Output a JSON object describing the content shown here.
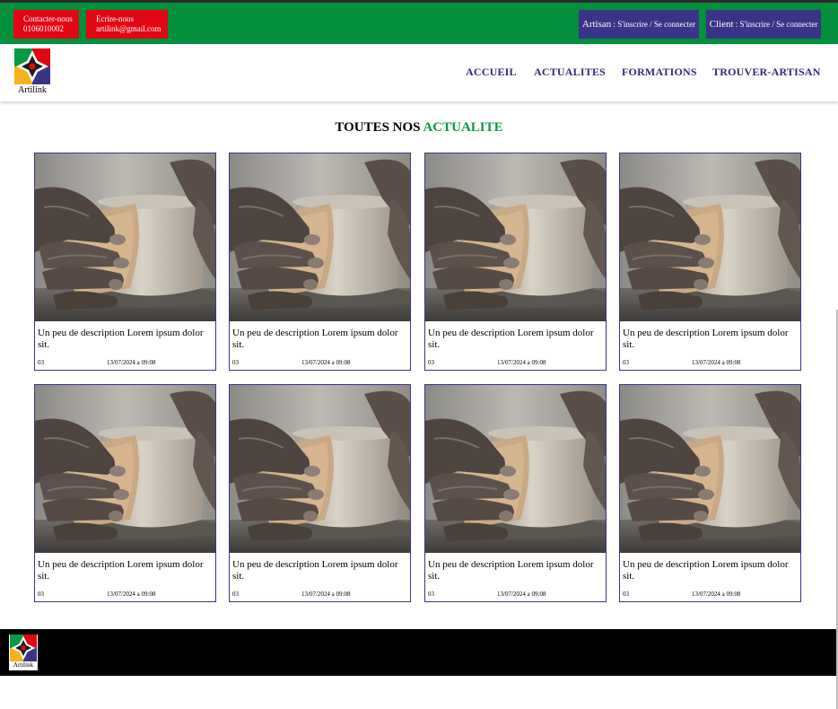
{
  "topbar": {
    "contact": {
      "label": "Contacter-nous",
      "value": "0106010002"
    },
    "write": {
      "label": "Ecrire-nous",
      "value": "artilink@gmail.com"
    },
    "artisan": {
      "role": "Artisan",
      "action": " : S'inscrire / Se connecter"
    },
    "client": {
      "role": "Client",
      "action": " : S'inscrire / Se connecter"
    }
  },
  "brand": {
    "name": "Artilink"
  },
  "nav": {
    "items": [
      {
        "label": "ACCUEIL"
      },
      {
        "label": "ACTUALITES"
      },
      {
        "label": "FORMATIONS"
      },
      {
        "label": "TROUVER-ARTISAN"
      }
    ]
  },
  "section": {
    "title_a": "TOUTES NOS ",
    "title_b": "ACTUALITE"
  },
  "cards": [
    {
      "description": "Un peu de description Lorem ipsum dolor sit.",
      "number": "03",
      "date": "13/07/2024 a 09:08"
    },
    {
      "description": "Un peu de description Lorem ipsum dolor sit.",
      "number": "03",
      "date": "13/07/2024 a 09:08"
    },
    {
      "description": "Un peu de description Lorem ipsum dolor sit.",
      "number": "03",
      "date": "13/07/2024 a 09:08"
    },
    {
      "description": "Un peu de description Lorem ipsum dolor sit.",
      "number": "03",
      "date": "13/07/2024 a 09:08"
    },
    {
      "description": "Un peu de description Lorem ipsum dolor sit.",
      "number": "03",
      "date": "13/07/2024 a 09:08"
    },
    {
      "description": "Un peu de description Lorem ipsum dolor sit.",
      "number": "03",
      "date": "13/07/2024 a 09:08"
    },
    {
      "description": "Un peu de description Lorem ipsum dolor sit.",
      "number": "03",
      "date": "13/07/2024 a 09:08"
    },
    {
      "description": "Un peu de description Lorem ipsum dolor sit.",
      "number": "03",
      "date": "13/07/2024 a 09:08"
    }
  ],
  "colors": {
    "topbar_green": "#038f3c",
    "contact_red": "#e30613",
    "login_blue": "#3a3488",
    "nav_text": "#2f2b7a",
    "title_accent": "#0a9a44",
    "footer": "#000000"
  },
  "icons": {
    "logo": "artilink-logo-icon",
    "card_image": "pottery-hands-photo"
  }
}
